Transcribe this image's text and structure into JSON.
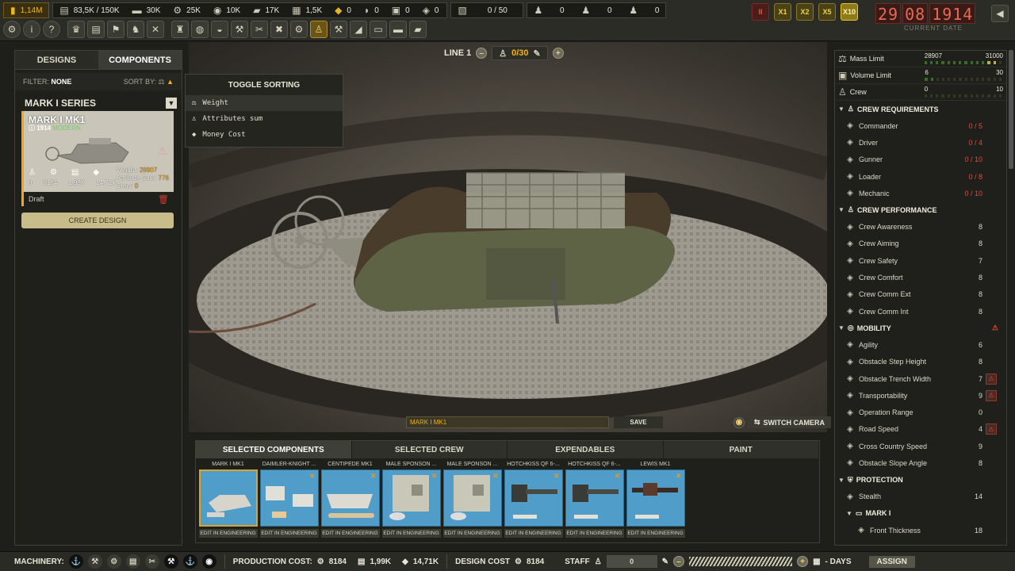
{
  "resources": [
    {
      "icon": "money-icon",
      "value": "1,14M",
      "gold": true
    },
    {
      "icon": "steel-icon",
      "value": "83,5K / 150K"
    },
    {
      "icon": "wood-icon",
      "value": "30K"
    },
    {
      "icon": "parts-icon",
      "value": "25K"
    },
    {
      "icon": "cloth-icon",
      "value": "10K"
    },
    {
      "icon": "ammo-icon",
      "value": "17K"
    },
    {
      "icon": "oil-icon",
      "value": "1,5K"
    },
    {
      "icon": "fuel-icon",
      "value": "0"
    },
    {
      "icon": "rubber-icon",
      "value": "0"
    },
    {
      "icon": "brass-icon",
      "value": "0"
    },
    {
      "icon": "explosive-icon",
      "value": "0"
    }
  ],
  "storage": "0 / 50",
  "workers": [
    "0",
    "0",
    "0"
  ],
  "speed": [
    "II",
    "X1",
    "X2",
    "X5",
    "X10"
  ],
  "date": [
    "29",
    "08",
    "1914"
  ],
  "date_label": "CURRENT DATE",
  "left": {
    "tab_designs": "DESIGNS",
    "tab_components": "COMPONENTS",
    "filter_label": "FILTER:",
    "filter_value": "NONE",
    "sort_label": "SORT BY:",
    "series": "MARK I SERIES",
    "card": {
      "name": "MARK I MK1",
      "year": "1914",
      "era": "MODERN",
      "weight_label": "Weight:",
      "weight": "28907",
      "attr_label": "Attribute Sum:",
      "attr": "776",
      "crew_label": "Crew:",
      "crew": "0",
      "n1": "0",
      "n2": "8184",
      "n3": "1,99K",
      "n4": "14,71K",
      "status": "Draft"
    },
    "create": "CREATE DESIGN"
  },
  "sort_popup": {
    "title": "TOGGLE SORTING",
    "options": [
      "Weight",
      "Attributes sum",
      "Money Cost"
    ]
  },
  "line": {
    "label": "LINE 1",
    "count": "0/30"
  },
  "design_name": "MARK I MK1",
  "save": "SAVE",
  "switch_camera": "SWITCH CAMERA",
  "bottom": {
    "tabs": [
      "SELECTED COMPONENTS",
      "SELECTED CREW",
      "EXPENDABLES",
      "PAINT"
    ],
    "components": [
      {
        "name": "MARK I MK1",
        "edit": "EDIT IN ENGINEERING"
      },
      {
        "name": "DAIMLER-KNIGHT ...",
        "edit": "EDIT IN ENGINEERING"
      },
      {
        "name": "CENTIPEDE MK1",
        "edit": "EDIT IN ENGINEERING"
      },
      {
        "name": "MALE SPONSON ...",
        "edit": "EDIT IN ENGINEERING"
      },
      {
        "name": "MALE SPONSON ...",
        "edit": "EDIT IN ENGINEERING"
      },
      {
        "name": "HOTCHKISS QF 6-...",
        "edit": "EDIT IN ENGINEERING"
      },
      {
        "name": "HOTCHKISS QF 6-...",
        "edit": "EDIT IN ENGINEERING"
      },
      {
        "name": "LEWIS MK1",
        "edit": "EDIT IN ENGINEERING"
      }
    ]
  },
  "limits": [
    {
      "label": "Mass Limit",
      "left": "28907",
      "right": "31000",
      "fill": 0.93
    },
    {
      "label": "Volume Limit",
      "left": "6",
      "right": "30",
      "fill": 0.2
    },
    {
      "label": "Crew",
      "left": "0",
      "right": "10",
      "fill": 0
    }
  ],
  "sections": {
    "crew_req": "CREW REQUIREMENTS",
    "crew_perf": "CREW PERFORMANCE",
    "mobility": "MOBILITY",
    "protection": "PROTECTION",
    "mark": "MARK I"
  },
  "crew_req": [
    [
      "Commander",
      "0 / 5"
    ],
    [
      "Driver",
      "0 / 4"
    ],
    [
      "Gunner",
      "0 / 10"
    ],
    [
      "Loader",
      "0 / 8"
    ],
    [
      "Mechanic",
      "0 / 10"
    ]
  ],
  "crew_perf": [
    [
      "Crew Awareness",
      "8"
    ],
    [
      "Crew Aiming",
      "8"
    ],
    [
      "Crew Safety",
      "7"
    ],
    [
      "Crew Comfort",
      "8"
    ],
    [
      "Crew Comm Ext",
      "8"
    ],
    [
      "Crew Comm Int",
      "8"
    ]
  ],
  "mobility": [
    [
      "Agility",
      "6"
    ],
    [
      "Obstacle Step Height",
      "8"
    ],
    [
      "Obstacle Trench Width",
      "7"
    ],
    [
      "Transportability",
      "9"
    ],
    [
      "Operation Range",
      "0"
    ],
    [
      "Road Speed",
      "4"
    ],
    [
      "Cross Country Speed",
      "9"
    ],
    [
      "Obstacle Slope Angle",
      "8"
    ]
  ],
  "protection": [
    [
      "Stealth",
      "14"
    ]
  ],
  "mark": [
    [
      "Front Thickness",
      "18"
    ]
  ],
  "bottombar": {
    "machinery": "MACHINERY:",
    "production_cost": "PRODUCTION COST:",
    "pc1": "8184",
    "pc2": "1,99K",
    "pc3": "14,71K",
    "design_cost": "DESIGN COST",
    "dc": "8184",
    "staff": "STAFF",
    "staff_value": "0",
    "days": "- DAYS",
    "assign": "ASSIGN"
  }
}
